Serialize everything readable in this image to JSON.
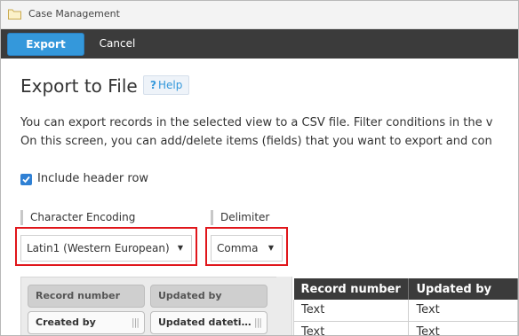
{
  "window": {
    "title": "Case Management",
    "icon": "folder-icon"
  },
  "toolbar": {
    "export_label": "Export",
    "cancel_label": "Cancel"
  },
  "page": {
    "title": "Export to File",
    "help_label": "Help",
    "desc_line1": "You can export records in the selected view to a CSV file. Filter conditions in the v",
    "desc_line2": "On this screen, you can add/delete items (fields) that you want to export and con"
  },
  "options": {
    "include_header_label": "Include header row",
    "include_header_checked": true,
    "encoding_label": "Character Encoding",
    "encoding_value": "Latin1 (Western European)",
    "delimiter_label": "Delimiter",
    "delimiter_value": "Comma"
  },
  "fields": {
    "selected": [
      "Record number",
      "Updated by"
    ],
    "available": [
      "Created by",
      "Updated dateti…"
    ]
  },
  "preview": {
    "headers": [
      "Record number",
      "Updated by"
    ],
    "rows": [
      [
        "Text",
        "Text"
      ],
      [
        "Text",
        "Text"
      ]
    ]
  },
  "colors": {
    "accent": "#3498db",
    "toolbar": "#3b3b3b",
    "highlight": "#e0161b"
  }
}
